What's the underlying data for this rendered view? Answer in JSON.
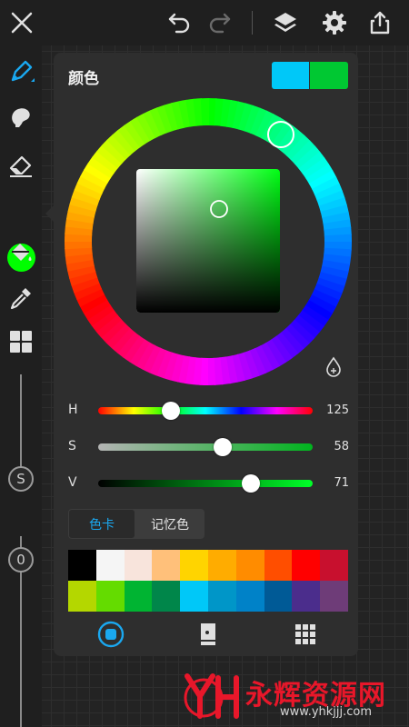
{
  "toolbar": {
    "icons": [
      "close-icon",
      "undo-icon",
      "redo-icon",
      "layers-icon",
      "gear-icon",
      "share-icon"
    ]
  },
  "sidebar": {
    "tools": [
      "brush-icon",
      "smudge-icon",
      "eraser-icon",
      "current-color",
      "fill-bucket-icon",
      "eyedropper-icon",
      "grid-icon"
    ],
    "current_color": "#00ff00",
    "size_slider_label": "S",
    "opacity_slider_label": "0"
  },
  "panel": {
    "title": "颜色",
    "previous_color": "#00c8f8",
    "new_color": "#00c832",
    "hsv": {
      "h": {
        "label": "H",
        "value": "125"
      },
      "s": {
        "label": "S",
        "value": "58"
      },
      "v": {
        "label": "V",
        "value": "71"
      }
    },
    "tabs": [
      {
        "label": "色卡",
        "active": true
      },
      {
        "label": "记忆色",
        "active": false
      }
    ],
    "palette_row1": [
      "#000000",
      "#f5f5f5",
      "#f8e4dc",
      "#ffc07a",
      "#ffd400",
      "#ffac00",
      "#ff8c00",
      "#ff4e00",
      "#ff0000",
      "#c8102e"
    ],
    "palette_row2": [
      "#b4d700",
      "#64dc00",
      "#00b432",
      "#00864a",
      "#00c8f8",
      "#0096c8",
      "#0082c8",
      "#005a96",
      "#4b2d8c",
      "#6e3c78"
    ],
    "bottom_tabs": [
      "wheel-mode-icon",
      "card-mode-icon",
      "palette-grid-icon"
    ]
  },
  "watermark": {
    "text": "永辉资源网",
    "url": "www.yhkjjj.com"
  }
}
